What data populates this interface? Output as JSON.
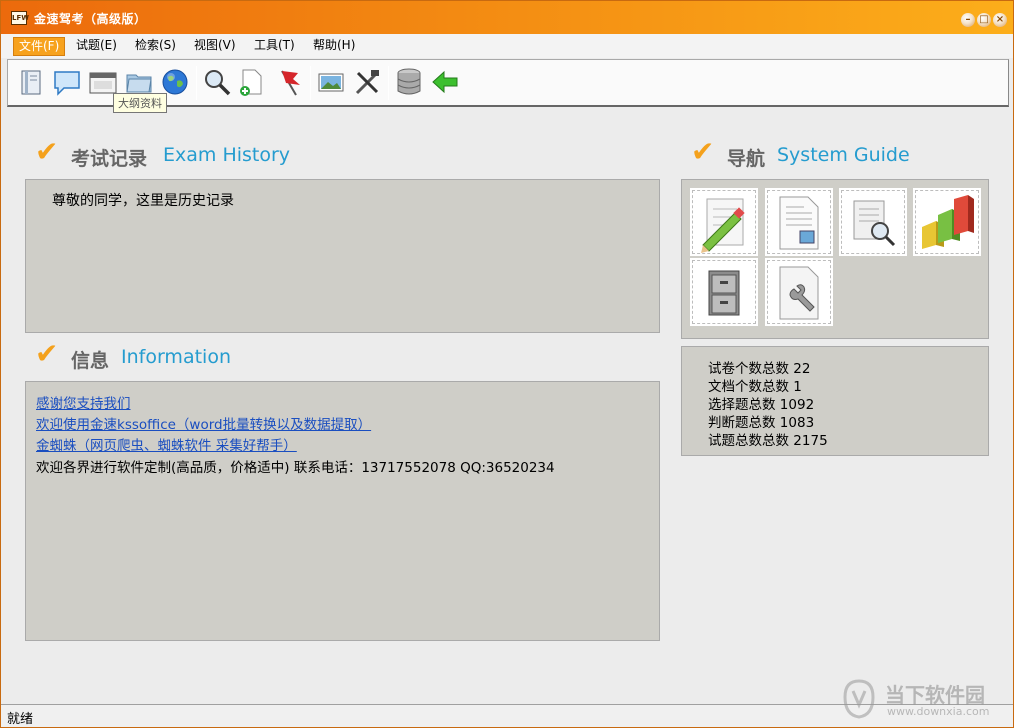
{
  "window": {
    "title": "金速驾考（高级版）",
    "app_icon_text": "LFW"
  },
  "menu": [
    {
      "label": "文件(F)",
      "active": true
    },
    {
      "label": "试题(E)"
    },
    {
      "label": "检索(S)"
    },
    {
      "label": "视图(V)"
    },
    {
      "label": "工具(T)"
    },
    {
      "label": "帮助(H)"
    }
  ],
  "toolbar": {
    "icons": [
      "book-icon",
      "chat-bubble-icon",
      "calendar-icon",
      "folder-icon",
      "globe-icon",
      "search-icon",
      "new-document-icon",
      "flag-icon",
      "picture-icon",
      "tools-icon",
      "database-icon",
      "back-arrow-icon"
    ],
    "tooltip": "大纲资料"
  },
  "exam_history": {
    "title_cn": "考试记录",
    "title_en": "Exam History",
    "text": "尊敬的同学，这里是历史记录"
  },
  "information": {
    "title_cn": "信息",
    "title_en": "Information",
    "lines": [
      {
        "text": "感谢您支持我们",
        "link": true
      },
      {
        "text": "欢迎使用金速kssoffice（word批量转换以及数据提取）",
        "link": true
      },
      {
        "text": "金蜘蛛（网页爬虫、蜘蛛软件 采集好帮手）",
        "link": true
      },
      {
        "text": "欢迎各界进行软件定制(高品质，价格适中) 联系电话：13717552078 QQ:36520234",
        "link": false
      }
    ]
  },
  "system_guide": {
    "title_cn": "导航",
    "title_en": "System Guide",
    "tiles": [
      "edit-document-icon",
      "document-image-icon",
      "document-search-icon",
      "bar-chart-icon",
      "cabinet-icon",
      "document-settings-icon"
    ]
  },
  "stats": [
    {
      "label": "试卷个数总数",
      "value": "22"
    },
    {
      "label": "文档个数总数",
      "value": "1"
    },
    {
      "label": "选择题总数",
      "value": "1092"
    },
    {
      "label": "判断题总数",
      "value": "1083"
    },
    {
      "label": "试题总数总数",
      "value": "2175"
    }
  ],
  "status": {
    "text": "就绪"
  },
  "watermark": {
    "text": "当下软件园",
    "url": "www.downxia.com"
  },
  "colors": {
    "titlebar": "#f38a12",
    "accent_check": "#f4a11c",
    "heading_en": "#259ccf",
    "link": "#1a4ec0",
    "panel": "#cfcec8"
  }
}
